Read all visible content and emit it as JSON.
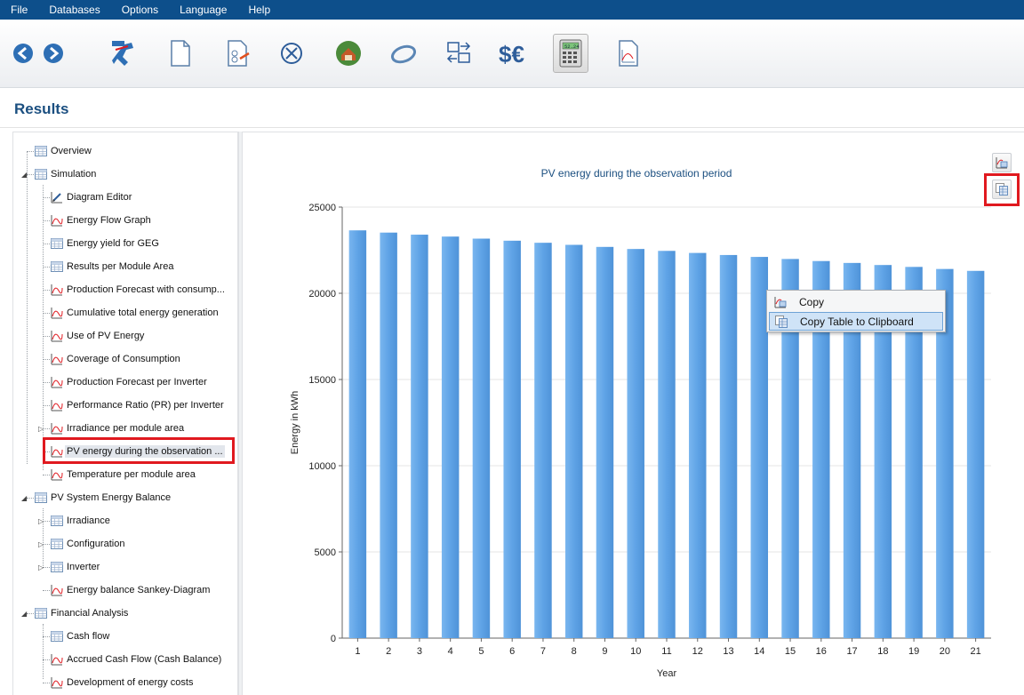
{
  "menu": [
    "File",
    "Databases",
    "Options",
    "Language",
    "Help"
  ],
  "toolbar": {
    "buttons": [
      "back-icon",
      "forward-icon",
      "project-runner-icon",
      "new-document-icon",
      "import-document-icon",
      "close-circle-icon",
      "3d-house-icon",
      "shading-ring-icon",
      "import-export-icon",
      "currency-icon",
      "calculator-icon",
      "chart-document-icon"
    ],
    "calculator_display": "52.24",
    "currency_text": "$€"
  },
  "page": {
    "title": "Results"
  },
  "tree": [
    {
      "label": "Overview",
      "level": 0,
      "icon": "table-icon",
      "expander": ""
    },
    {
      "label": "Simulation",
      "level": 0,
      "icon": "table-icon",
      "expander": "◢"
    },
    {
      "label": "Diagram Editor",
      "level": 1,
      "icon": "diagram-edit-icon",
      "expander": ""
    },
    {
      "label": "Energy Flow Graph",
      "level": 1,
      "icon": "chart-icon",
      "expander": ""
    },
    {
      "label": "Energy yield for GEG",
      "level": 1,
      "icon": "table-icon",
      "expander": ""
    },
    {
      "label": "Results per Module Area",
      "level": 1,
      "icon": "table-icon",
      "expander": ""
    },
    {
      "label": "Production Forecast with consump...",
      "level": 1,
      "icon": "chart-icon",
      "expander": ""
    },
    {
      "label": "Cumulative total energy generation",
      "level": 1,
      "icon": "chart-icon",
      "expander": ""
    },
    {
      "label": "Use of PV Energy",
      "level": 1,
      "icon": "chart-icon",
      "expander": ""
    },
    {
      "label": "Coverage of Consumption",
      "level": 1,
      "icon": "chart-icon",
      "expander": ""
    },
    {
      "label": "Production Forecast per Inverter",
      "level": 1,
      "icon": "chart-icon",
      "expander": ""
    },
    {
      "label": "Performance Ratio (PR) per Inverter",
      "level": 1,
      "icon": "chart-icon",
      "expander": ""
    },
    {
      "label": "Irradiance per module area",
      "level": 1,
      "icon": "chart-icon",
      "expander": "▷"
    },
    {
      "label": "PV energy during the observation ...",
      "level": 1,
      "icon": "chart-icon",
      "expander": "",
      "selected": true
    },
    {
      "label": "Temperature per module area",
      "level": 1,
      "icon": "chart-icon",
      "expander": ""
    },
    {
      "label": "PV System Energy Balance",
      "level": 0,
      "icon": "table-icon",
      "expander": "◢"
    },
    {
      "label": "Irradiance",
      "level": 1,
      "icon": "table-icon",
      "expander": "▷"
    },
    {
      "label": "Configuration",
      "level": 1,
      "icon": "table-icon",
      "expander": "▷"
    },
    {
      "label": "Inverter",
      "level": 1,
      "icon": "table-icon",
      "expander": "▷"
    },
    {
      "label": "Energy balance Sankey-Diagram",
      "level": 1,
      "icon": "chart-icon",
      "expander": ""
    },
    {
      "label": "Financial Analysis",
      "level": 0,
      "icon": "table-icon",
      "expander": "◢"
    },
    {
      "label": "Cash flow",
      "level": 1,
      "icon": "table-icon",
      "expander": ""
    },
    {
      "label": "Accrued Cash Flow (Cash Balance)",
      "level": 1,
      "icon": "chart-icon",
      "expander": ""
    },
    {
      "label": "Development of energy costs",
      "level": 1,
      "icon": "chart-icon",
      "expander": ""
    }
  ],
  "context_menu": {
    "items": [
      {
        "label": "Copy",
        "icon": "copy-chart-icon"
      },
      {
        "label": "Copy Table to Clipboard",
        "icon": "copy-table-icon",
        "hover": true
      }
    ]
  },
  "colors": {
    "accent": "#0d4f8b",
    "bar": "#5fa3e6",
    "highlight": "#e0191f",
    "title": "#1b4f80"
  },
  "chart_data": {
    "type": "bar",
    "title": "PV energy during the observation period",
    "xlabel": "Year",
    "ylabel": "Energy in kWh",
    "ylim": [
      0,
      25000
    ],
    "yticks": [
      0,
      5000,
      10000,
      15000,
      20000,
      25000
    ],
    "categories": [
      "1",
      "2",
      "3",
      "4",
      "5",
      "6",
      "7",
      "8",
      "9",
      "10",
      "11",
      "12",
      "13",
      "14",
      "15",
      "16",
      "17",
      "18",
      "19",
      "20",
      "21"
    ],
    "values": [
      23650,
      23520,
      23400,
      23290,
      23170,
      23050,
      22930,
      22810,
      22690,
      22570,
      22460,
      22340,
      22220,
      22110,
      21990,
      21870,
      21760,
      21640,
      21530,
      21410,
      21300
    ],
    "grid": true,
    "legend": "none"
  }
}
